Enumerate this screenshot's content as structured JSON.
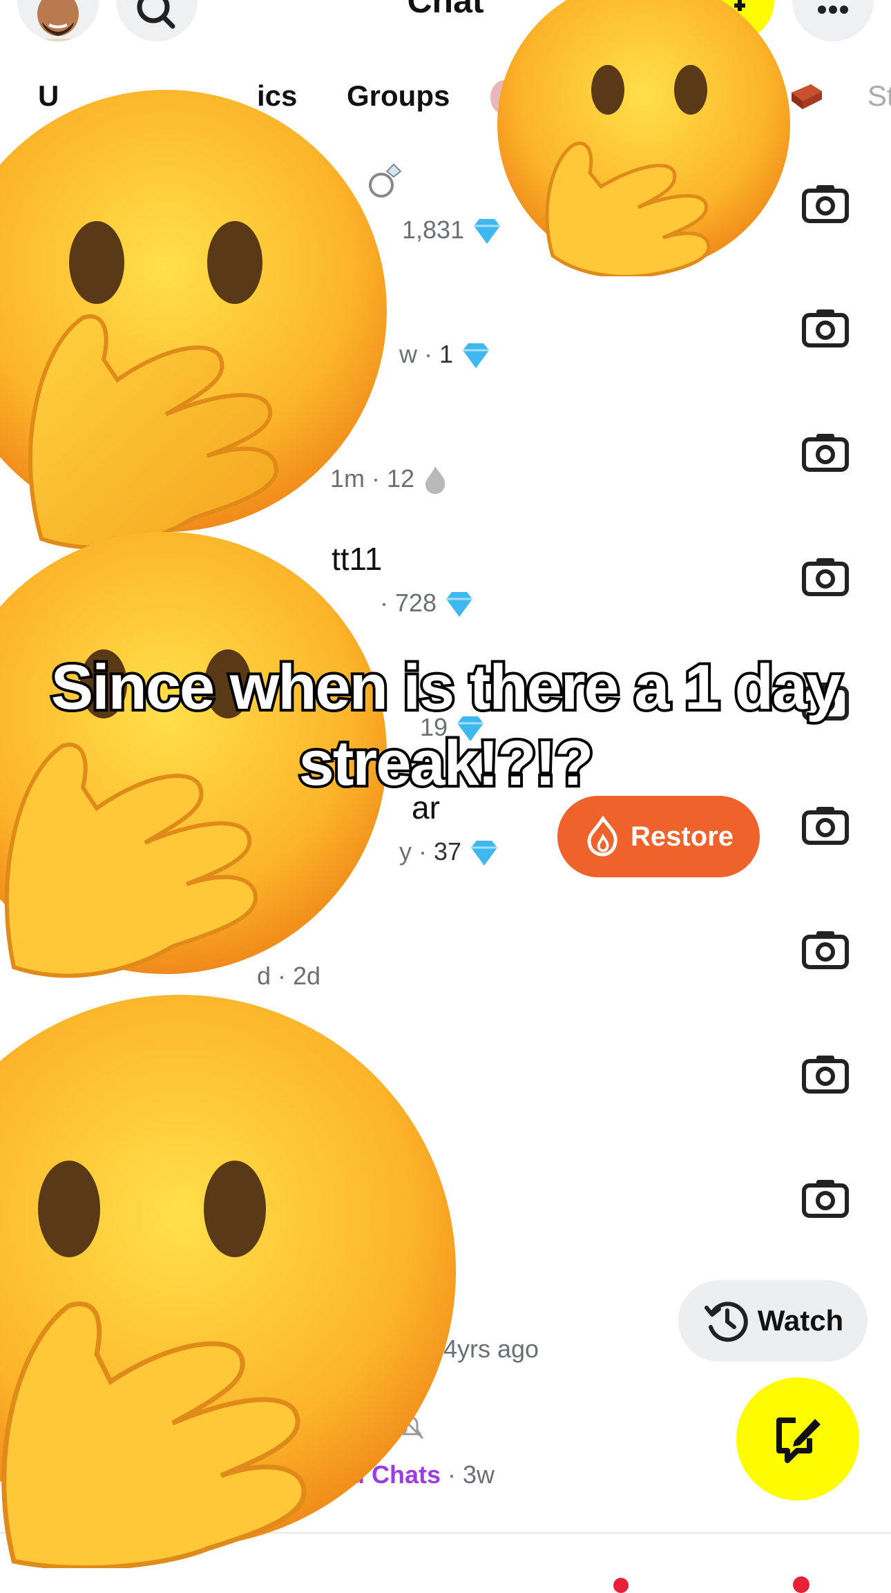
{
  "header": {
    "title": "Chat",
    "icons": [
      "bitmoji-avatar",
      "search-icon",
      "add-friend-icon",
      "more-icon"
    ]
  },
  "tabs": [
    {
      "label": "U"
    },
    {
      "label": "ics"
    },
    {
      "label": "Groups"
    },
    {
      "label": "St"
    }
  ],
  "rows": [
    {
      "name": "",
      "status": "1,831",
      "badge": "gem-icon",
      "extra_icon": "ring-icon"
    },
    {
      "name": "",
      "status_prefix": "w ·",
      "status": "1",
      "badge": "gem-icon"
    },
    {
      "name": "",
      "status_prefix": "1m ·",
      "status": "12",
      "badge": "faded-fire-icon"
    },
    {
      "name": "tt11",
      "status_prefix": "·",
      "status": "728",
      "badge": "gem-icon"
    },
    {
      "name": "",
      "status": "19",
      "badge": "gem-icon"
    },
    {
      "name": "ar",
      "status_prefix": "y ·",
      "status": "37",
      "badge": "gem-icon"
    },
    {
      "name": "",
      "status": "d · 2d"
    },
    {
      "name": "",
      "status": ""
    },
    {
      "name": "",
      "status": ""
    },
    {
      "name": "",
      "status": "· 4yrs ago"
    },
    {
      "name": "",
      "status_highlight": "nd Chats",
      "status": "· 3w",
      "extra_icon": "muted-bell-icon"
    }
  ],
  "restore_button": {
    "label": "Restore"
  },
  "watch_button": {
    "label": "Watch"
  },
  "caption": {
    "line1": "Since when is there a 1 day",
    "line2": "streak!?!?"
  },
  "colors": {
    "restore": "#f0622b",
    "snap_yellow": "#fffc00",
    "gem": "#3fb7f0",
    "highlight": "#9b3ce6"
  }
}
